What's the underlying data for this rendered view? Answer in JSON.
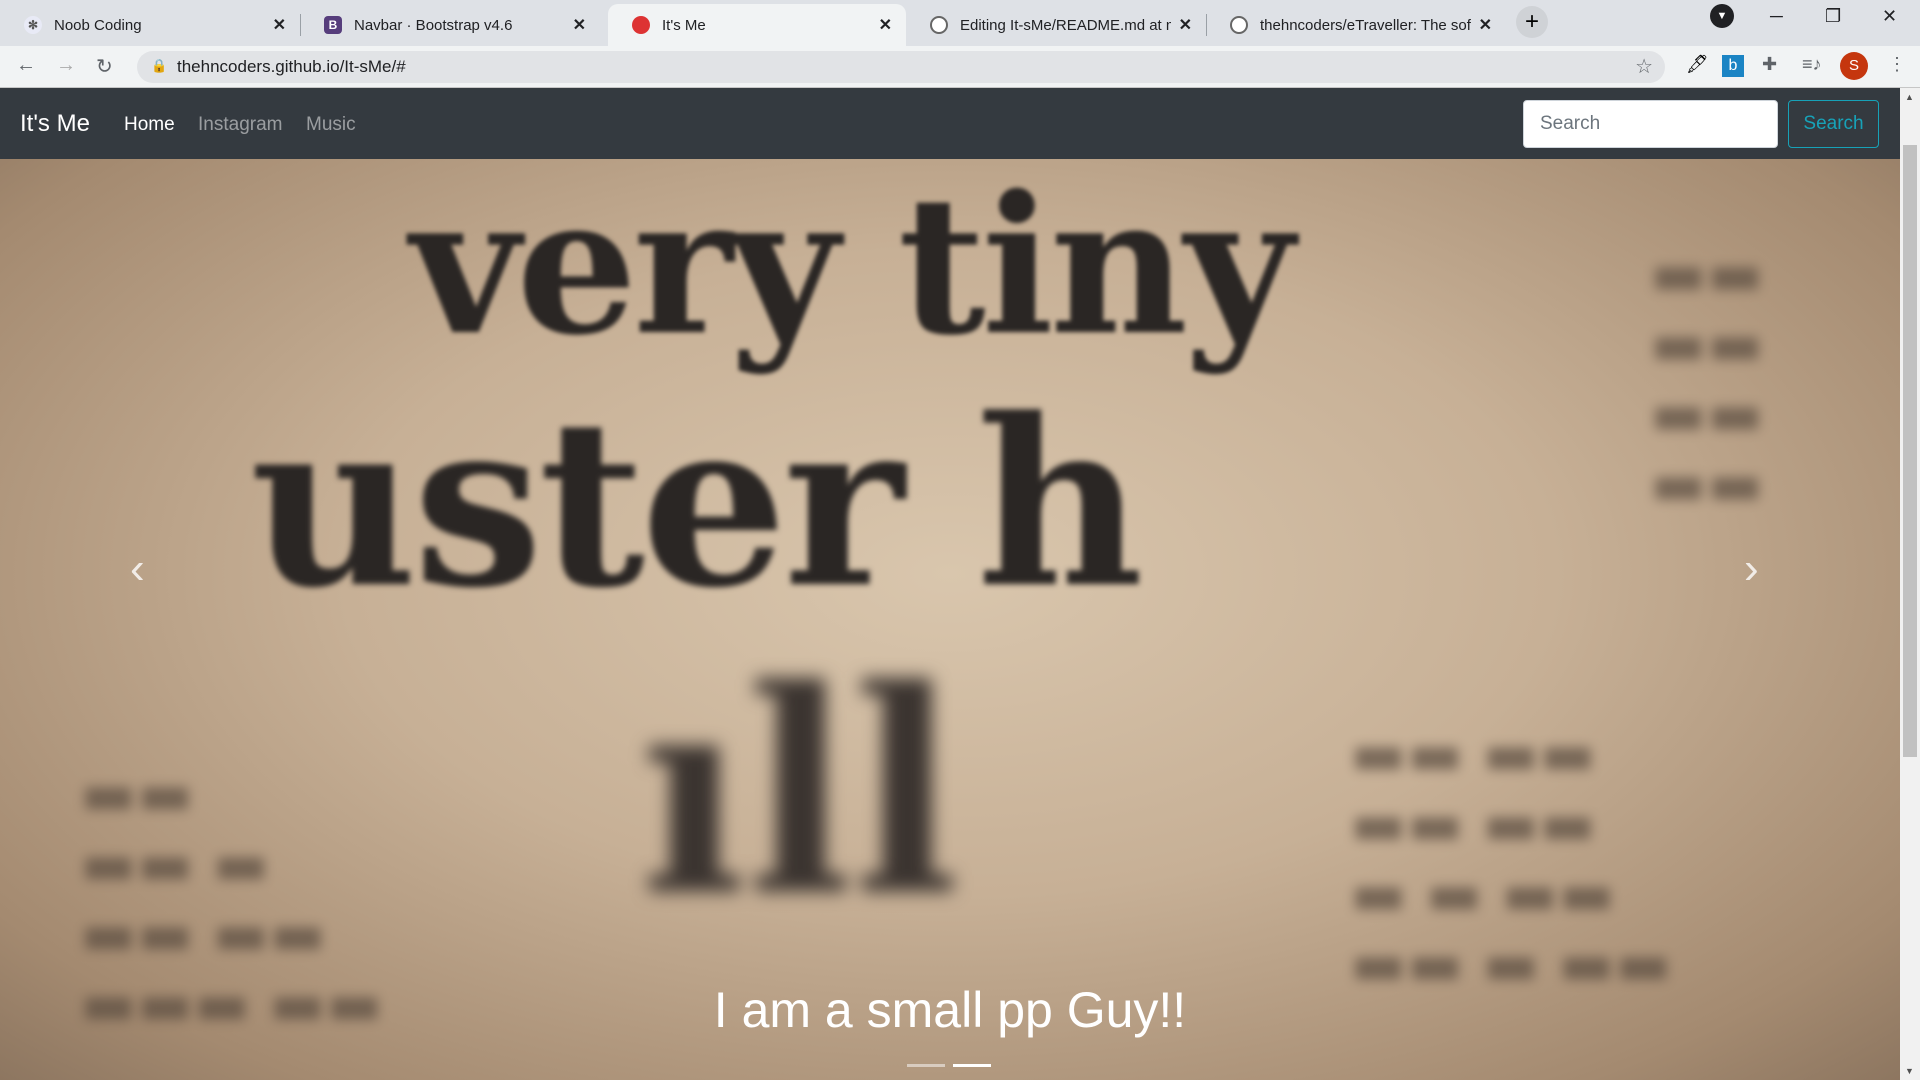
{
  "browser": {
    "tabs": [
      {
        "title": "Noob Coding",
        "active": false
      },
      {
        "title": "Navbar · Bootstrap v4.6",
        "active": false
      },
      {
        "title": "It's Me",
        "active": true
      },
      {
        "title": "Editing It-sMe/README.md at ma",
        "active": false
      },
      {
        "title": "thehncoders/eTraveller: The softw",
        "active": false
      }
    ],
    "url": "thehncoders.github.io/It-sMe/#",
    "profile_initial": "S"
  },
  "navbar": {
    "brand": "It's Me",
    "links": [
      {
        "label": "Home",
        "active": true
      },
      {
        "label": "Instagram"
      },
      {
        "label": "Music"
      }
    ],
    "search_placeholder": "Search",
    "search_button": "Search"
  },
  "hero": {
    "image_text": [
      "very tiny",
      "uster h",
      "ıll"
    ],
    "caption": "I am a small pp Guy!!",
    "slides": 2,
    "active_slide": 1
  }
}
